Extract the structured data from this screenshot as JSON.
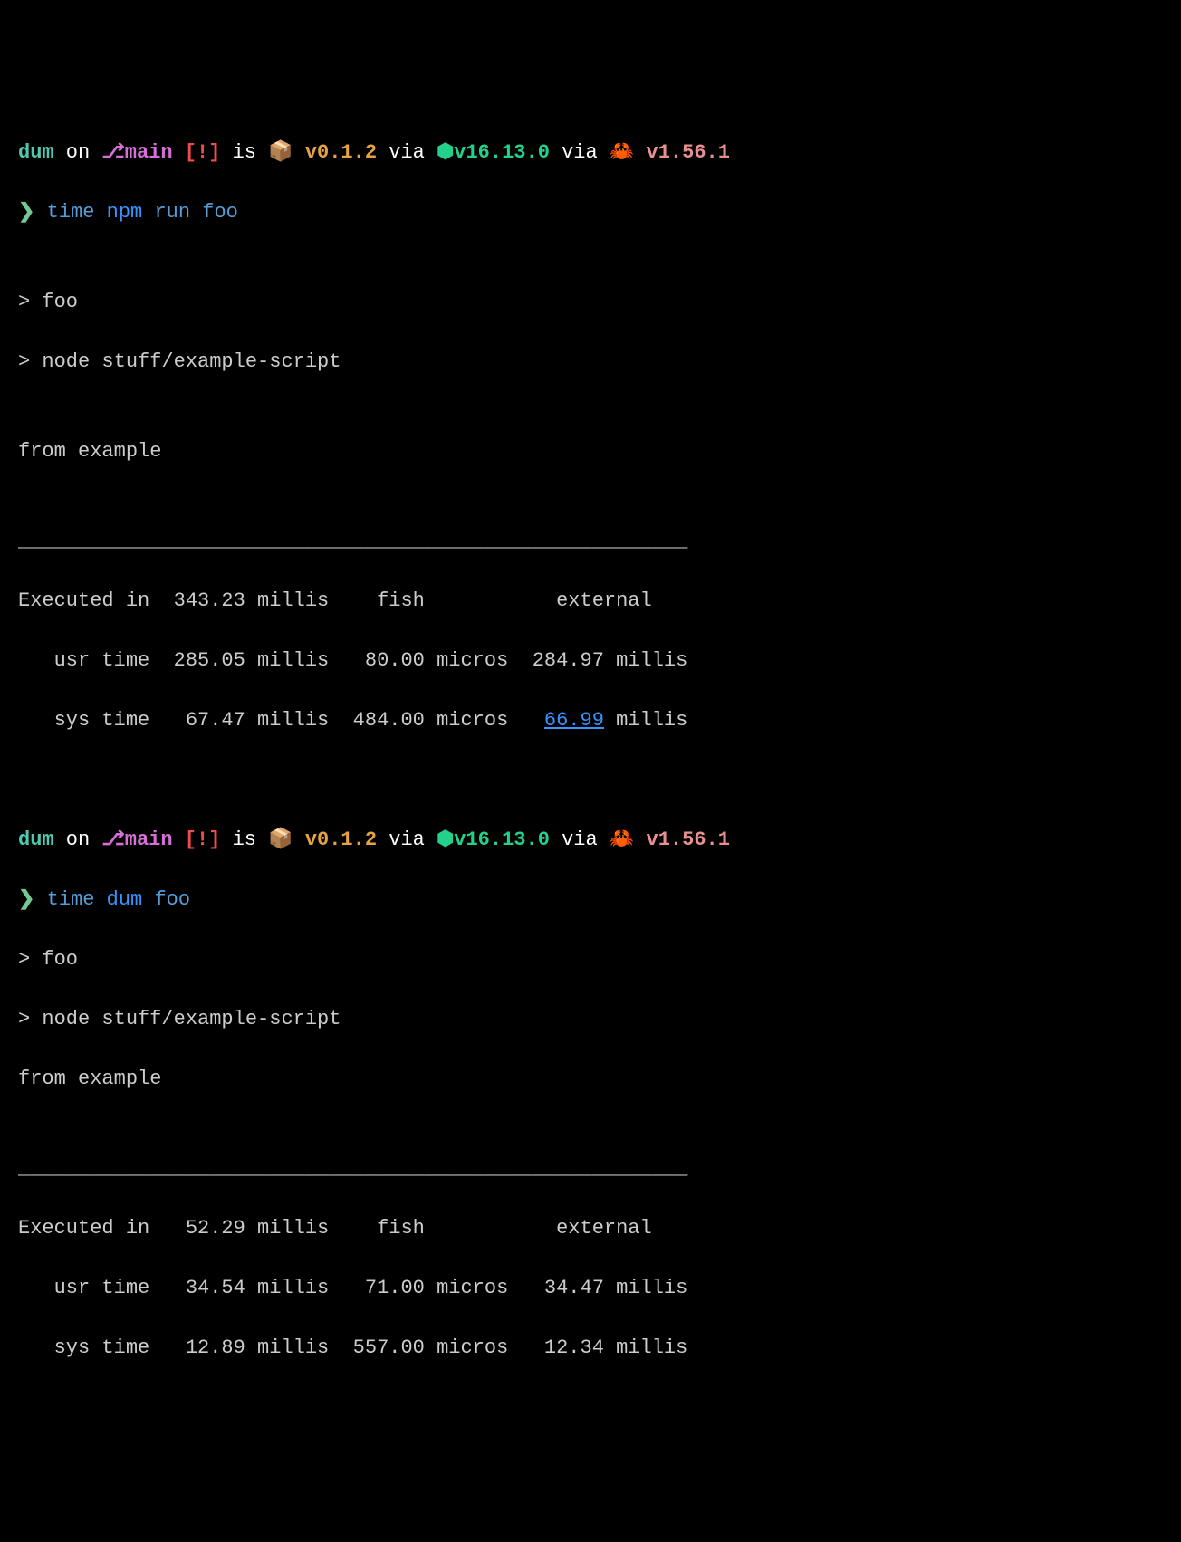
{
  "prompt": {
    "project": "dum",
    "on": " on ",
    "branch_icon": "⎇",
    "branch": "main",
    "status": " [!]",
    "is": " is ",
    "package_emoji": "📦",
    "package_version": " v0.1.2",
    "via1": " via ",
    "node_icon": "⬢",
    "node_version": "v16.13.0",
    "via2": " via ",
    "rust_emoji": "🦀",
    "rust_version": " v1.56.1",
    "arrow": "❯"
  },
  "block1": {
    "cmd_time": " time",
    "cmd_npm": " npm",
    "cmd_run": " run",
    "cmd_foo": " foo",
    "out1": "> foo",
    "out2": "> node stuff/example-script",
    "out3": "from example",
    "divider": "________________________________________________________",
    "timing": {
      "row1": "Executed in  343.23 millis    fish           external",
      "row2": "   usr time  285.05 millis   80.00 micros  284.97 millis",
      "row3_pre": "   sys time   67.47 millis  484.00 micros   ",
      "row3_link": "66.99",
      "row3_post": " millis"
    }
  },
  "block2": {
    "cmd_time": " time",
    "cmd_dum": " dum",
    "cmd_foo": " foo",
    "out1": "> foo",
    "out2": "> node stuff/example-script",
    "out3": "from example",
    "divider": "________________________________________________________",
    "timing": {
      "row1": "Executed in   52.29 millis    fish           external",
      "row2": "   usr time   34.54 millis   71.00 micros   34.47 millis",
      "row3": "   sys time   12.89 millis  557.00 micros   12.34 millis"
    }
  }
}
